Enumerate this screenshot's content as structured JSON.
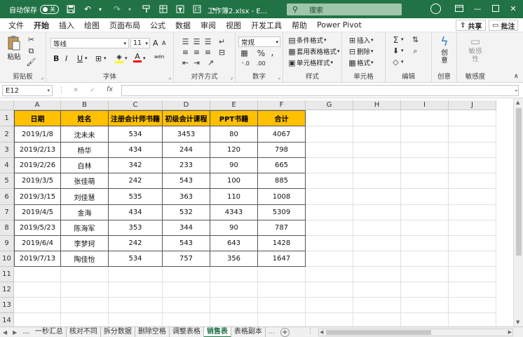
{
  "titlebar": {
    "autosave_label": "自动保存",
    "autosave_state": "关",
    "filename": "工作簿2.xlsx - E...",
    "search_placeholder": "搜索"
  },
  "menu": {
    "items": [
      "文件",
      "开始",
      "插入",
      "绘图",
      "页面布局",
      "公式",
      "数据",
      "审阅",
      "视图",
      "开发工具",
      "帮助",
      "Power Pivot"
    ],
    "active": "开始",
    "share_label": "共享",
    "comment_label": "批注"
  },
  "ribbon": {
    "clipboard": {
      "paste": "粘贴",
      "label": "剪贴板"
    },
    "font": {
      "name": "等线",
      "size": "11",
      "label": "字体",
      "bold": "B",
      "italic": "I",
      "underline": "U",
      "grow": "A",
      "shrink": "A",
      "font_color": "A",
      "phonetic": "wén"
    },
    "alignment": {
      "label": "对齐方式"
    },
    "number": {
      "format": "常规",
      "label": "数字"
    },
    "styles": {
      "conditional": "条件格式",
      "table": "套用表格格式",
      "cell": "单元格样式",
      "label": "样式"
    },
    "cells": {
      "insert": "插入",
      "delete": "删除",
      "format": "格式",
      "label": "单元格"
    },
    "editing": {
      "label": "编辑"
    },
    "create": {
      "btn": "创意",
      "label": "创意"
    },
    "sensitivity": {
      "btn": "敏感性",
      "label": "敏感度"
    }
  },
  "formula_bar": {
    "name_box": "E12",
    "fx": "fx",
    "value": ""
  },
  "sheet": {
    "columns": [
      "A",
      "B",
      "C",
      "D",
      "E",
      "F",
      "G",
      "H",
      "I",
      "J"
    ],
    "rows": [
      "1",
      "2",
      "3",
      "4",
      "5",
      "6",
      "7",
      "8",
      "9",
      "10",
      "11",
      "12",
      "13",
      "14"
    ],
    "headers": [
      "日期",
      "姓名",
      "注册会计师书籍",
      "初级会计课程",
      "PPT书籍",
      "合计"
    ],
    "data": [
      [
        "2019/1/8",
        "沈未未",
        "534",
        "3453",
        "80",
        "4067"
      ],
      [
        "2019/2/13",
        "杨华",
        "434",
        "244",
        "120",
        "798"
      ],
      [
        "2019/2/26",
        "白林",
        "342",
        "233",
        "90",
        "665"
      ],
      [
        "2019/3/5",
        "张佳萌",
        "242",
        "543",
        "100",
        "885"
      ],
      [
        "2019/3/15",
        "刘佳慧",
        "535",
        "363",
        "110",
        "1008"
      ],
      [
        "2019/4/5",
        "金海",
        "434",
        "532",
        "4343",
        "5309"
      ],
      [
        "2019/5/23",
        "陈海军",
        "353",
        "344",
        "90",
        "787"
      ],
      [
        "2019/6/4",
        "李梦珂",
        "242",
        "543",
        "643",
        "1428"
      ],
      [
        "2019/7/13",
        "陶佳怡",
        "534",
        "757",
        "356",
        "1647"
      ]
    ]
  },
  "sheet_tabs": {
    "ellipsis": "...",
    "tabs": [
      "一秒汇总",
      "核对不同",
      "拆分数据",
      "删除空格",
      "调整表格",
      "销售表",
      "表格副本"
    ],
    "active": "销售表",
    "add": "+"
  },
  "colors": {
    "accent": "#217346",
    "header_fill": "#ffc000"
  }
}
